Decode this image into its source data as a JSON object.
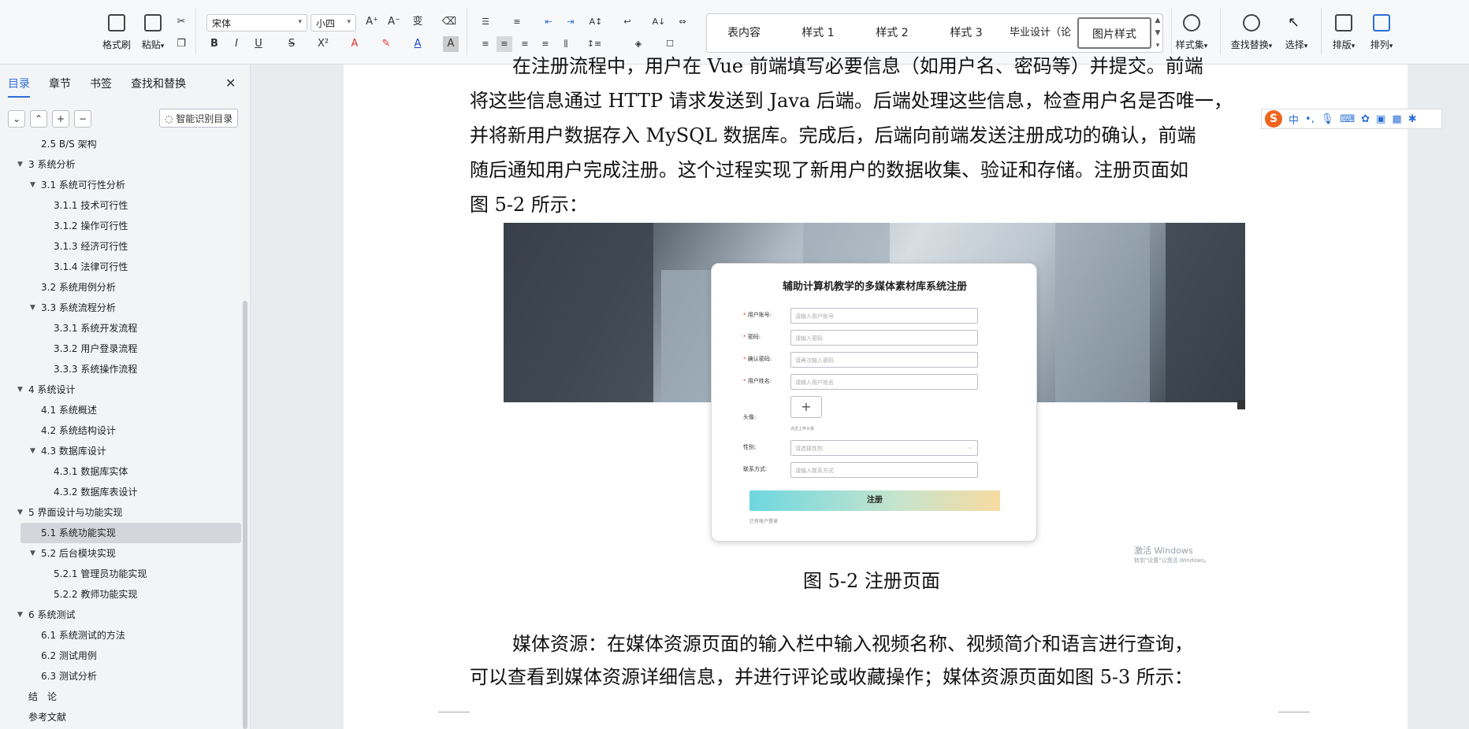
{
  "ribbon": {
    "format_painter": "格式刷",
    "paste": "粘贴",
    "font_name": "宋体",
    "font_size": "小四",
    "styles": [
      "表内容",
      "样式 1",
      "样式 2",
      "样式 3",
      "毕业设计（论",
      "图片样式"
    ],
    "style_set": "样式集",
    "find_replace": "查找替换",
    "select": "选择",
    "layout": "排版",
    "arrange": "排列"
  },
  "sidebar": {
    "tabs": [
      "目录",
      "章节",
      "书签",
      "查找和替换"
    ],
    "smart_toc": "智能识别目录",
    "toc": [
      {
        "label": "2.5 B/S 架构",
        "level": 2,
        "expanded": null
      },
      {
        "label": "3 系统分析",
        "level": 1,
        "expanded": true
      },
      {
        "label": "3.1 系统可行性分析",
        "level": 2,
        "expanded": true
      },
      {
        "label": "3.1.1 技术可行性",
        "level": 3,
        "expanded": null
      },
      {
        "label": "3.1.2 操作可行性",
        "level": 3,
        "expanded": null
      },
      {
        "label": "3.1.3 经济可行性",
        "level": 3,
        "expanded": null
      },
      {
        "label": "3.1.4 法律可行性",
        "level": 3,
        "expanded": null
      },
      {
        "label": "3.2 系统用例分析",
        "level": 2,
        "expanded": null
      },
      {
        "label": "3.3 系统流程分析",
        "level": 2,
        "expanded": true
      },
      {
        "label": "3.3.1 系统开发流程",
        "level": 3,
        "expanded": null
      },
      {
        "label": "3.3.2 用户登录流程",
        "level": 3,
        "expanded": null
      },
      {
        "label": "3.3.3 系统操作流程",
        "level": 3,
        "expanded": null
      },
      {
        "label": "4 系统设计",
        "level": 1,
        "expanded": true
      },
      {
        "label": "4.1 系统概述",
        "level": 2,
        "expanded": null
      },
      {
        "label": "4.2 系统结构设计",
        "level": 2,
        "expanded": null
      },
      {
        "label": "4.3 数据库设计",
        "level": 2,
        "expanded": true
      },
      {
        "label": "4.3.1 数据库实体",
        "level": 3,
        "expanded": null
      },
      {
        "label": "4.3.2 数据库表设计",
        "level": 3,
        "expanded": null
      },
      {
        "label": "5 界面设计与功能实现",
        "level": 1,
        "expanded": true
      },
      {
        "label": "5.1 系统功能实现",
        "level": 2,
        "expanded": null,
        "selected": true
      },
      {
        "label": "5.2 后台模块实现",
        "level": 2,
        "expanded": true
      },
      {
        "label": "5.2.1 管理员功能实现",
        "level": 3,
        "expanded": null
      },
      {
        "label": "5.2.2 教师功能实现",
        "level": 3,
        "expanded": null
      },
      {
        "label": "6 系统测试",
        "level": 1,
        "expanded": true
      },
      {
        "label": "6.1 系统测试的方法",
        "level": 2,
        "expanded": null
      },
      {
        "label": "6.2 测试用例",
        "level": 2,
        "expanded": null
      },
      {
        "label": "6.3 测试分析",
        "level": 2,
        "expanded": null
      },
      {
        "label": "结　论",
        "level": 1,
        "expanded": null
      },
      {
        "label": "参考文献",
        "level": 1,
        "expanded": null
      }
    ]
  },
  "document": {
    "lines": [
      "在注册流程中，用户在 Vue 前端填写必要信息（如用户名、密码等）并提交。前端",
      "将这些信息通过 HTTP 请求发送到 Java 后端。后端处理这些信息，检查用户名是否唯一，",
      "并将新用户数据存入 MySQL 数据库。完成后，后端向前端发送注册成功的确认，前端",
      "随后通知用户完成注册。这个过程实现了新用户的数据收集、验证和存储。注册页面如",
      "图 5-2 所示："
    ],
    "figure_caption": "图 5-2 注册页面",
    "lines_after": [
      "媒体资源：在媒体资源页面的输入栏中输入视频名称、视频简介和语言进行查询，",
      "可以查看到媒体资源详细信息，并进行评论或收藏操作；媒体资源页面如图 5-3 所示："
    ]
  },
  "register_form": {
    "title": "辅助计算机教学的多媒体素材库系统注册",
    "fields": [
      {
        "label": "用户账号:",
        "placeholder": "请输入用户账号",
        "required": true
      },
      {
        "label": "密码:",
        "placeholder": "请输入密码",
        "required": true
      },
      {
        "label": "确认密码:",
        "placeholder": "请再次输入密码",
        "required": true
      },
      {
        "label": "用户姓名:",
        "placeholder": "请输入用户姓名",
        "required": true
      }
    ],
    "avatar_label": "头像:",
    "avatar_hint": "点击上传头像",
    "gender_label": "性别:",
    "gender_placeholder": "请选择性别",
    "contact_label": "联系方式:",
    "contact_placeholder": "请输入联系方式",
    "submit": "注册",
    "login_link": "已有账户登录",
    "upload_plus": "+"
  },
  "watermark": {
    "line1": "激活 Windows",
    "line2": "转到\"设置\"以激活 Windows。"
  },
  "ime": {
    "logo": "S",
    "mode": "中"
  }
}
